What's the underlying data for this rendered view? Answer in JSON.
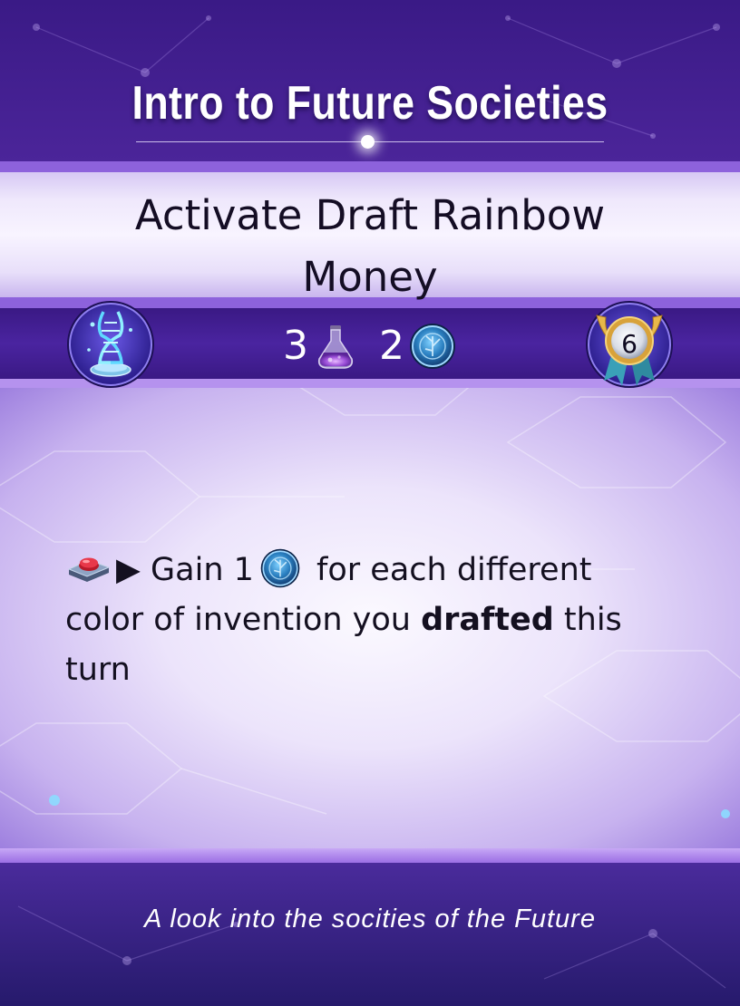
{
  "card": {
    "title": "Intro to Future Societies",
    "name_line1": "Activate Draft Rainbow",
    "name_line2": "Money",
    "cost": {
      "flask_count": "3",
      "coin_count": "2"
    },
    "left_badge_icon": "dna-hologram-icon",
    "right_medal": {
      "icon": "winged-medal-icon",
      "value": "6"
    },
    "ability": {
      "trigger_icon": "red-button-icon",
      "arrow": "▶",
      "part1": " Gain 1",
      "coin_icon": "circuit-coin-icon",
      "part2": " for each different color of invention you ",
      "bold": "drafted",
      "part3": " this turn"
    },
    "flavor": "A look into the socities of the Future"
  },
  "colors": {
    "frame_purple": "#4a24a0",
    "band_violet": "#8d62dc",
    "panel_light": "#f8f4ff",
    "coin_blue": "#2a7fc0",
    "text_dark": "#140d24"
  }
}
